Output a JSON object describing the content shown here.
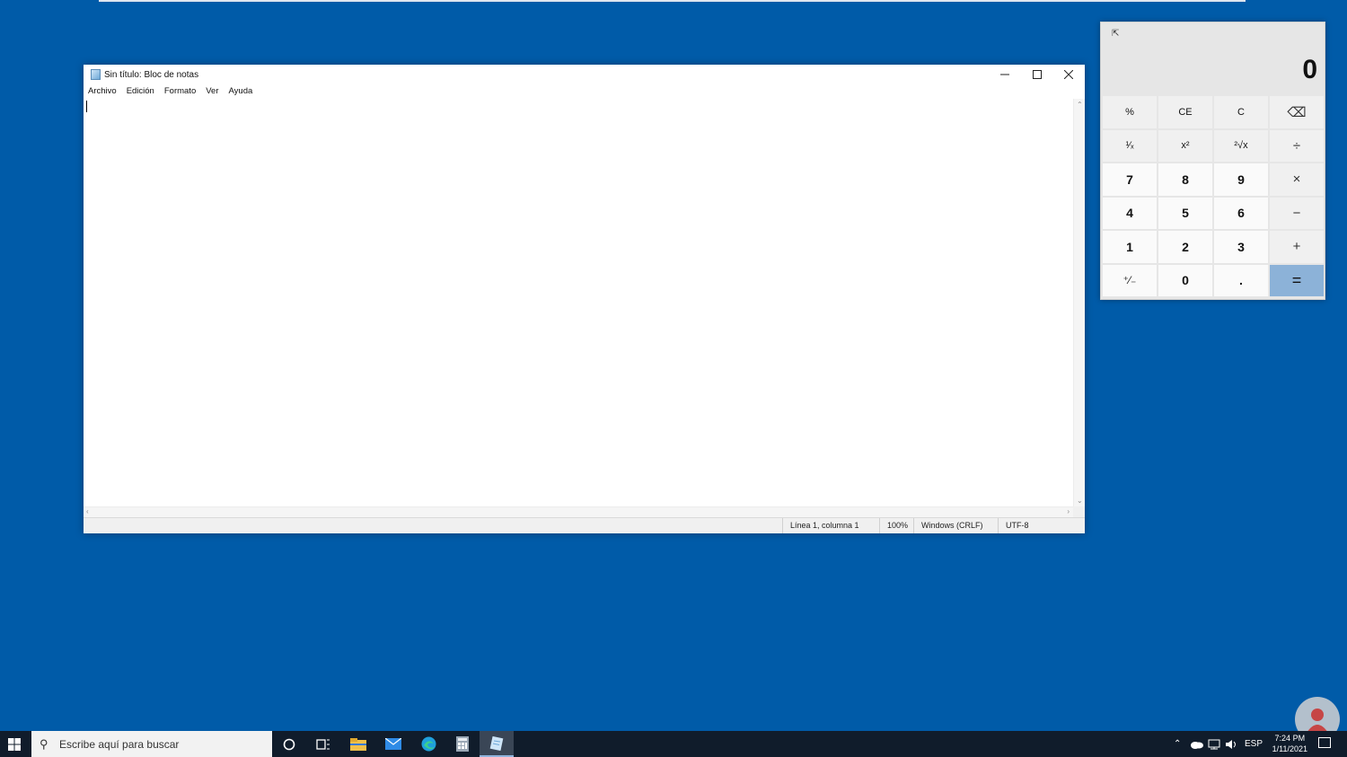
{
  "notepad": {
    "title": "Sin título: Bloc de notas",
    "menu": [
      "Archivo",
      "Edición",
      "Formato",
      "Ver",
      "Ayuda"
    ],
    "content": "",
    "status": {
      "position": "Línea 1, columna 1",
      "zoom": "100%",
      "line_ending": "Windows (CRLF)",
      "encoding": "UTF-8"
    }
  },
  "calculator": {
    "display": "0",
    "keys": [
      [
        "%",
        "CE",
        "C",
        "⌫"
      ],
      [
        "¹⁄ₓ",
        "x²",
        "²√x",
        "÷"
      ],
      [
        "7",
        "8",
        "9",
        "×"
      ],
      [
        "4",
        "5",
        "6",
        "−"
      ],
      [
        "1",
        "2",
        "3",
        "+"
      ],
      [
        "⁺⁄₋",
        "0",
        ".",
        "="
      ]
    ]
  },
  "taskbar": {
    "search_placeholder": "Escribe aquí para buscar",
    "language": "ESP",
    "time": "7:24 PM",
    "date": "1/11/2021"
  },
  "colors": {
    "desktop": "#005ba8",
    "taskbar": "#101c2b",
    "equals_key": "#8cb2d8"
  }
}
